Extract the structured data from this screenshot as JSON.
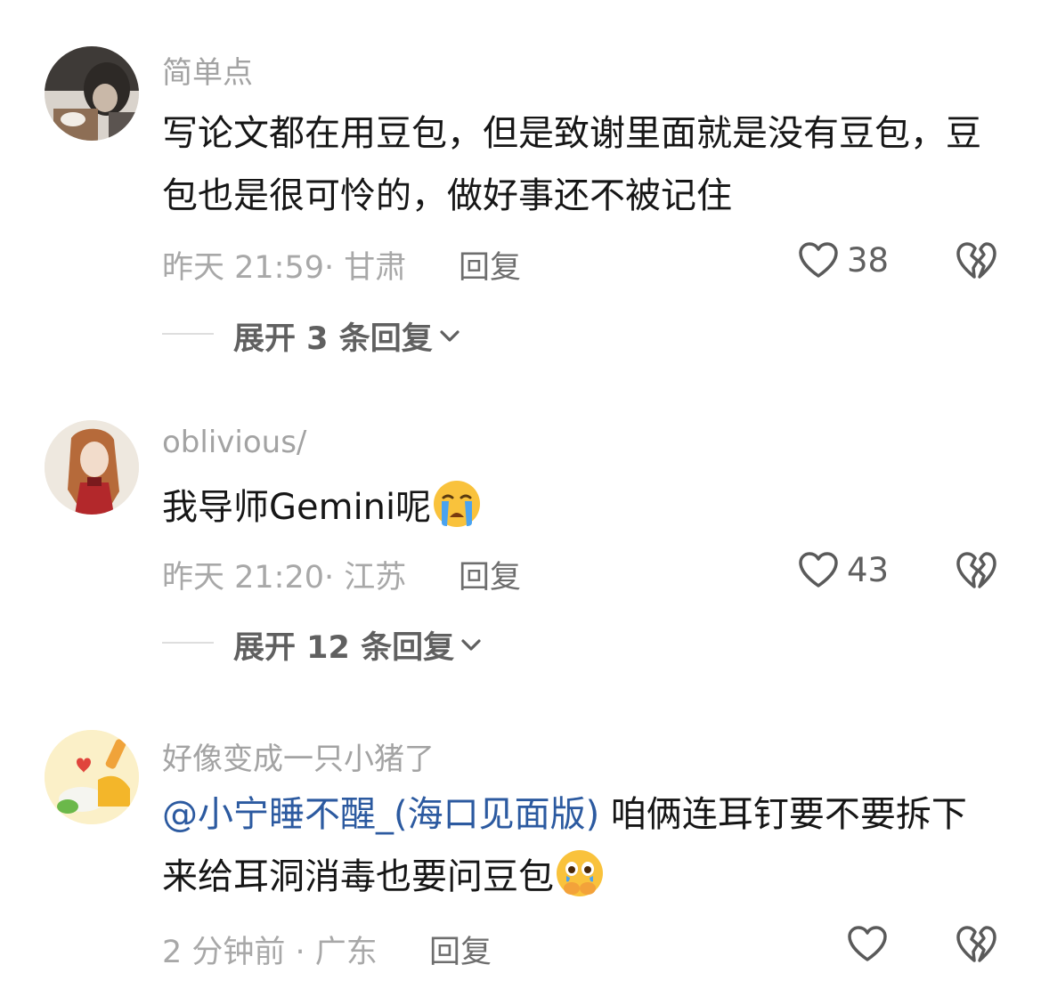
{
  "comments": [
    {
      "username": "简单点",
      "text": "写论文都在用豆包，但是致谢里面就是没有豆包，豆包也是很可怜的，做好事还不被记住",
      "time_location": "昨天 21:59· 甘肃",
      "reply_label": "回复",
      "likes": "38",
      "expand_label": "展开 3 条回复"
    },
    {
      "username": "oblivious/",
      "text": "我导师Gemini呢",
      "emoji": "loudly-crying-face",
      "time_location": "昨天 21:20· 江苏",
      "reply_label": "回复",
      "likes": "43",
      "expand_label": "展开 12 条回复"
    },
    {
      "username": "好像变成一只小猪了",
      "mention": "@小宁睡不醒_(海口见面版)",
      "text": " 咱俩连耳钉要不要拆下来给耳洞消毒也要问豆包",
      "emoji": "face-holding-back-tears",
      "time_location": "2 分钟前 · 广东",
      "reply_label": "回复",
      "likes": ""
    }
  ],
  "icons": {
    "like": "heart-outline-icon",
    "dislike": "broken-heart-icon",
    "expand": "chevron-down-icon"
  },
  "colors": {
    "mention": "#2c5aa0",
    "emoji_yellow": "#f9c23c"
  }
}
